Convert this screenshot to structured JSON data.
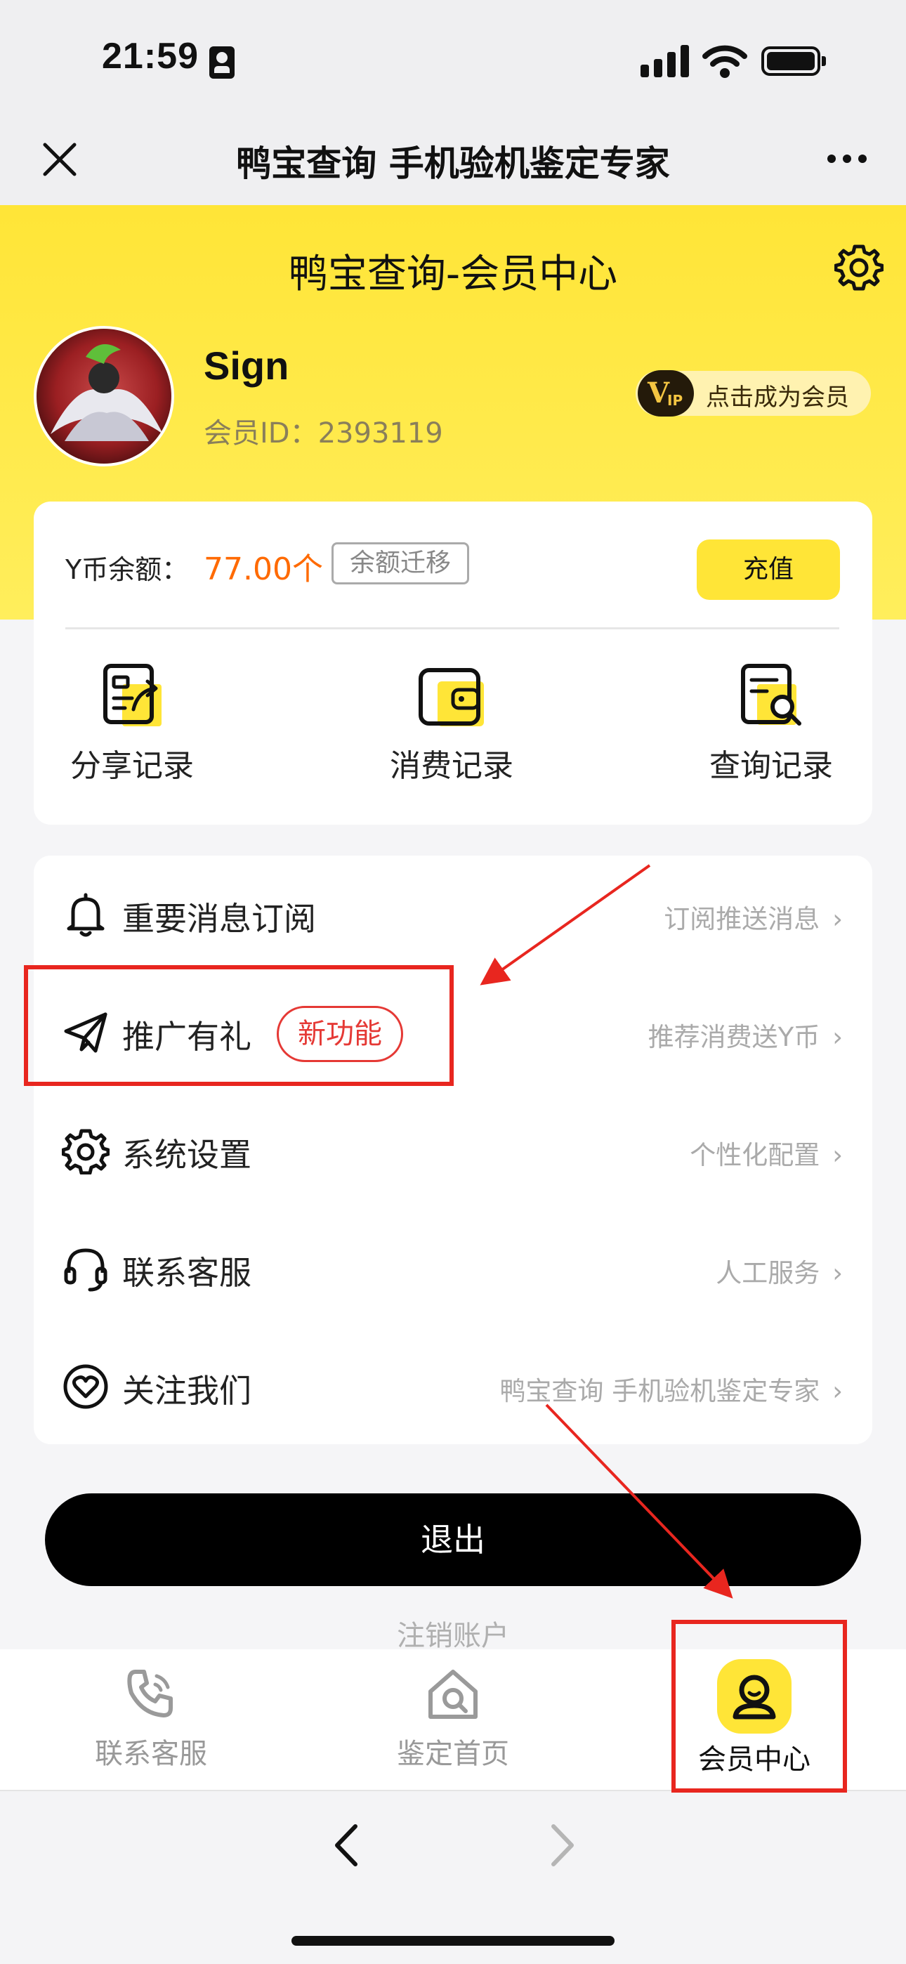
{
  "status_bar": {
    "time": "21:59"
  },
  "nav_bar": {
    "title": "鸭宝查询 手机验机鉴定专家"
  },
  "header": {
    "page_title": "鸭宝查询-会员中心",
    "username": "Sign",
    "member_id": "会员ID：2393119",
    "vip_button": "点击成为会员",
    "vip_badge_text": "VIP"
  },
  "wallet": {
    "balance_label": "Y币余额：",
    "balance_value": "77.00个",
    "transfer_button": "余额迁移",
    "recharge_button": "充值",
    "records": [
      {
        "label": "分享记录",
        "icon": "share-record-icon"
      },
      {
        "label": "消费记录",
        "icon": "wallet-icon"
      },
      {
        "label": "查询记录",
        "icon": "search-record-icon"
      }
    ]
  },
  "menu": [
    {
      "label": "重要消息订阅",
      "hint": "订阅推送消息",
      "icon": "bell-icon"
    },
    {
      "label": "推广有礼",
      "hint": "推荐消费送Y币",
      "icon": "paper-plane-icon",
      "badge": "新功能"
    },
    {
      "label": "系统设置",
      "hint": "个性化配置",
      "icon": "gear-icon"
    },
    {
      "label": "联系客服",
      "hint": "人工服务",
      "icon": "headset-icon"
    },
    {
      "label": "关注我们",
      "hint": "鸭宝查询 手机验机鉴定专家",
      "icon": "heart-icon"
    }
  ],
  "logout_button": "退出",
  "deregister_link": "注销账户",
  "tabs": [
    {
      "label": "联系客服",
      "icon": "phone-icon",
      "active": false
    },
    {
      "label": "鉴定首页",
      "icon": "home-search-icon",
      "active": false
    },
    {
      "label": "会员中心",
      "icon": "user-icon",
      "active": true
    }
  ],
  "colors": {
    "brand_yellow": "#ffe537",
    "balance_orange": "#ff6a00",
    "annotation_red": "#e8261f"
  }
}
